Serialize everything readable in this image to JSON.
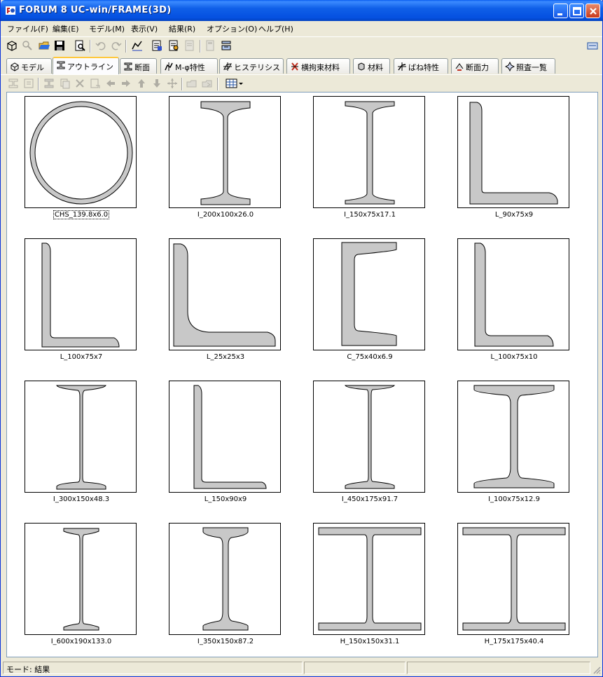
{
  "window": {
    "title": "FORUM 8 UC-win/FRAME(3D)"
  },
  "menu": [
    {
      "label": "ファイル(F)"
    },
    {
      "label": "編集(E)"
    },
    {
      "label": "モデル(M)"
    },
    {
      "label": "表示(V)"
    },
    {
      "label": "結果(R)"
    },
    {
      "label": "オプション(O)"
    },
    {
      "label": "ヘルプ(H)"
    }
  ],
  "tabs": [
    {
      "label": "モデル",
      "icon": "model-icon"
    },
    {
      "label": "アウトライン",
      "icon": "outline-icon",
      "active": true
    },
    {
      "label": "断面",
      "icon": "section-icon"
    },
    {
      "label": "M-φ特性",
      "icon": "m-phi-icon"
    },
    {
      "label": "ヒステリシス",
      "icon": "hysteresis-icon"
    },
    {
      "label": "横拘束材料",
      "icon": "lateral-restraint-icon"
    },
    {
      "label": "材料",
      "icon": "material-icon"
    },
    {
      "label": "ばね特性",
      "icon": "spring-icon"
    },
    {
      "label": "断面力",
      "icon": "section-force-icon"
    },
    {
      "label": "照査一覧",
      "icon": "check-list-icon"
    }
  ],
  "outlines": [
    {
      "label": "CHS_139.8x6.0",
      "shape": "circle",
      "selected": true
    },
    {
      "label": "I_200x100x26.0",
      "shape": "I"
    },
    {
      "label": "I_150x75x17.1",
      "shape": "I"
    },
    {
      "label": "L_90x75x9",
      "shape": "L"
    },
    {
      "label": "L_100x75x7",
      "shape": "L"
    },
    {
      "label": "L_25x25x3",
      "shape": "L"
    },
    {
      "label": "C_75x40x6.9",
      "shape": "C"
    },
    {
      "label": "L_100x75x10",
      "shape": "L"
    },
    {
      "label": "I_300x150x48.3",
      "shape": "I"
    },
    {
      "label": "L_150x90x9",
      "shape": "L"
    },
    {
      "label": "I_450x175x91.7",
      "shape": "I"
    },
    {
      "label": "I_100x75x12.9",
      "shape": "I"
    },
    {
      "label": "I_600x190x133.0",
      "shape": "I"
    },
    {
      "label": "I_350x150x87.2",
      "shape": "I"
    },
    {
      "label": "H_150x150x31.1",
      "shape": "H"
    },
    {
      "label": "H_175x175x40.4",
      "shape": "H"
    }
  ],
  "status": {
    "mode": "モード: 結果"
  },
  "colors": {
    "shape_fill": "#C8C8C8",
    "titlebar": "#0550E0"
  }
}
